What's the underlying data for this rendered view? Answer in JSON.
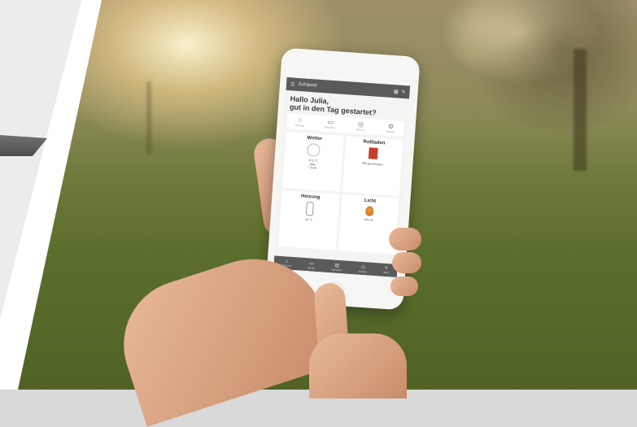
{
  "app": {
    "header_title": "Zuhause",
    "greeting_line1": "Hallo Julia,",
    "greeting_line2": "gut in den Tag gestartet?"
  },
  "quick_actions": [
    {
      "icon": "home-icon",
      "glyph": "⌂",
      "label": "Zuhause"
    },
    {
      "icon": "scene-icon",
      "glyph": "▭",
      "label": "Szenarien"
    },
    {
      "icon": "camera-icon",
      "glyph": "◎",
      "label": "Kamera"
    },
    {
      "icon": "settings-icon",
      "glyph": "⚙",
      "label": "Einstell."
    }
  ],
  "tiles": {
    "weather": {
      "title": "Wetter",
      "line1": "12,5 °C",
      "line2": "80%",
      "line3": "7 km/h"
    },
    "shutters": {
      "title": "Rollladen",
      "line1": "Alle geschlossen"
    },
    "heating": {
      "title": "Heizung",
      "line1": "20 °C"
    },
    "light": {
      "title": "Licht",
      "line1": "Alle an"
    }
  },
  "bottom_nav": [
    {
      "glyph": "⌂",
      "label": "Zuhause"
    },
    {
      "glyph": "▭",
      "label": "Geräte"
    },
    {
      "glyph": "▤",
      "label": "Szenarien"
    },
    {
      "glyph": "◷",
      "label": "Zeitplan"
    },
    {
      "glyph": "≡",
      "label": "Mehr"
    }
  ],
  "colors": {
    "shutter_accent": "#c83e2c",
    "light_accent": "#e89a3a",
    "appbar": "#5a5a5a"
  }
}
